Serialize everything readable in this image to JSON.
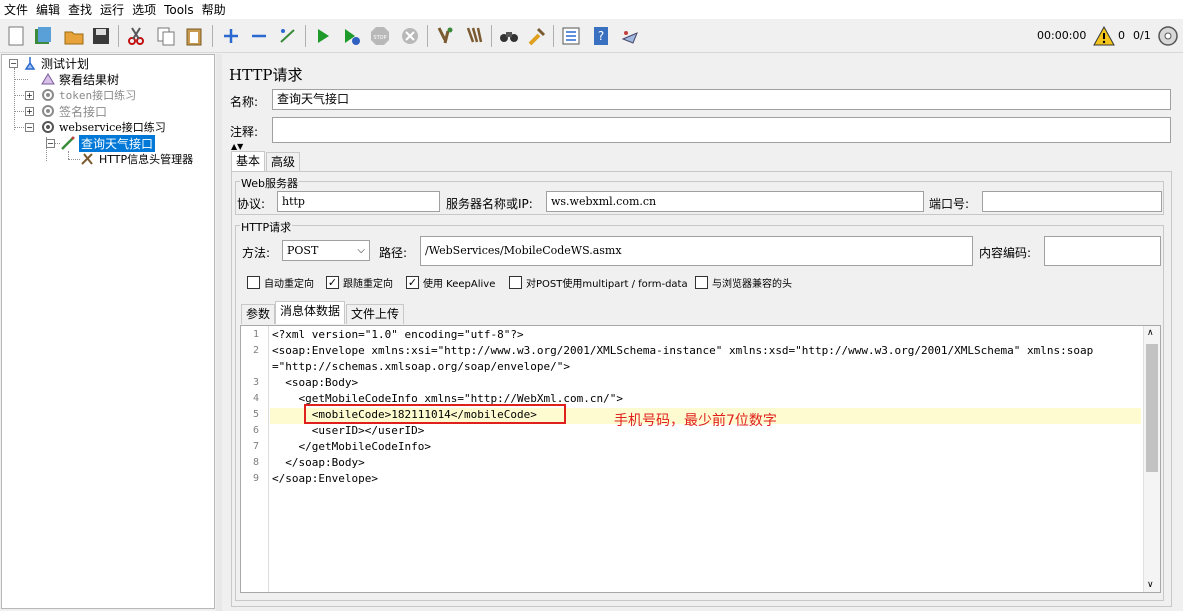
{
  "menubar": {
    "items": [
      "文件",
      "编辑",
      "查找",
      "运行",
      "选项",
      "Tools",
      "帮助"
    ]
  },
  "toolbar": {
    "timer": "00:00:00",
    "warnings": "0",
    "threads": "0/1"
  },
  "tree": {
    "items": [
      {
        "label": "测试计划",
        "icon": "test-plan-icon"
      },
      {
        "label": "察看结果树",
        "icon": "listener-icon"
      },
      {
        "label": "token接口练习",
        "icon": "thread-group-icon",
        "disabled": true
      },
      {
        "label": "签名接口",
        "icon": "thread-group-icon",
        "disabled": true
      },
      {
        "label": "webservice接口练习",
        "icon": "thread-group-icon"
      },
      {
        "label": "查询天气接口",
        "icon": "sampler-icon",
        "selected": true
      },
      {
        "label": "HTTP信息头管理器",
        "icon": "config-tool-icon"
      }
    ]
  },
  "panel": {
    "title": "HTTP请求",
    "name_label": "名称:",
    "name_value": "查询天气接口",
    "comment_label": "注释:",
    "comment_value": "",
    "tabs": [
      "基本",
      "高级"
    ],
    "web_server": {
      "title": "Web服务器",
      "protocol_label": "协议:",
      "protocol_value": "http",
      "server_label": "服务器名称或IP:",
      "server_value": "ws.webxml.com.cn",
      "port_label": "端口号:",
      "port_value": ""
    },
    "http_request": {
      "title": "HTTP请求",
      "method_label": "方法:",
      "method_value": "POST",
      "path_label": "路径:",
      "path_value": "/WebServices/MobileCodeWS.asmx",
      "encoding_label": "内容编码:",
      "encoding_value": ""
    },
    "checkboxes": [
      {
        "label": "自动重定向",
        "checked": false
      },
      {
        "label": "跟随重定向",
        "checked": true
      },
      {
        "label": "使用 KeepAlive",
        "checked": true
      },
      {
        "label": "对POST使用multipart / form-data",
        "checked": false
      },
      {
        "label": "与浏览器兼容的头",
        "checked": false
      }
    ],
    "subtabs": [
      "参数",
      "消息体数据",
      "文件上传"
    ],
    "body_lines": [
      {
        "num": "1",
        "text": "<?xml version=\"1.0\" encoding=\"utf-8\"?>"
      },
      {
        "num": "2",
        "text": "<soap:Envelope xmlns:xsi=\"http://www.w3.org/2001/XMLSchema-instance\" xmlns:xsd=\"http://www.w3.org/2001/XMLSchema\" xmlns:soap"
      },
      {
        "num": "",
        "text": "=\"http://schemas.xmlsoap.org/soap/envelope/\">"
      },
      {
        "num": "3",
        "text": "  <soap:Body>"
      },
      {
        "num": "4",
        "text": "    <getMobileCodeInfo xmlns=\"http://WebXml.com.cn/\">"
      },
      {
        "num": "5",
        "text": "      <mobileCode>182111014</mobileCode>"
      },
      {
        "num": "6",
        "text": "      <userID></userID>"
      },
      {
        "num": "7",
        "text": "    </getMobileCodeInfo>"
      },
      {
        "num": "8",
        "text": "  </soap:Body>"
      },
      {
        "num": "9",
        "text": "</soap:Envelope>"
      }
    ],
    "annotation": "手机号码，最少前7位数字"
  },
  "colors": {
    "selection": "#0078d7",
    "annotation": "#e0201c",
    "highlight_line": "#fefbd0",
    "xml_value": "#2a00ff"
  }
}
